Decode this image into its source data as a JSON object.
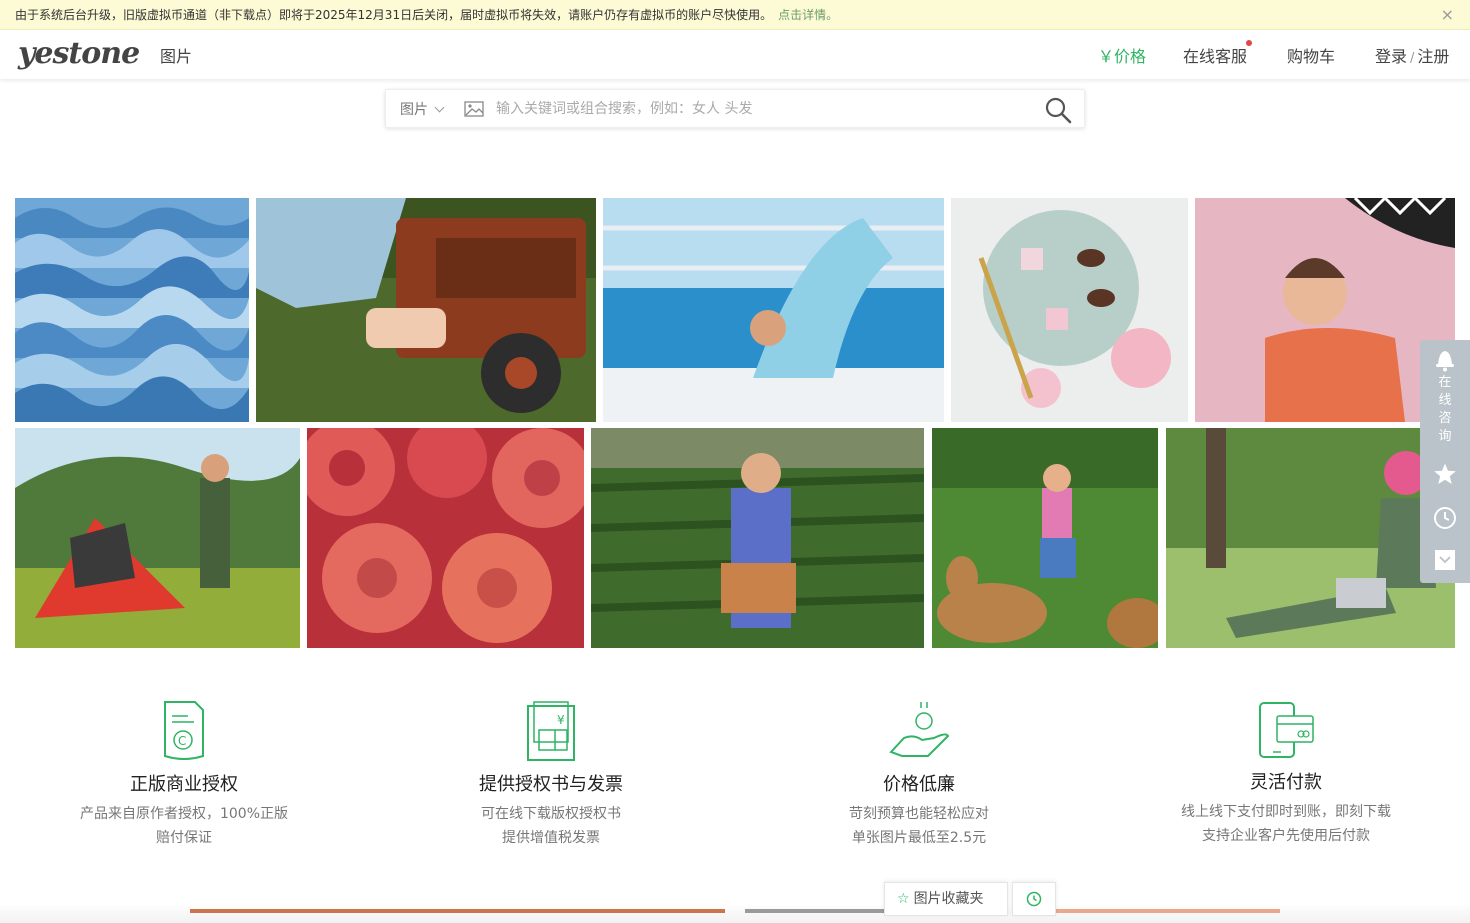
{
  "notice": {
    "text": "由于系统后台升级，旧版虚拟币通道（非下载点）即将于2025年12月31日后关闭，届时虚拟币将失效，请账户仍存有虚拟币的账户尽快使用。",
    "link": "点击详情。",
    "close": "×"
  },
  "header": {
    "logo": "yestone",
    "nav_pictures": "图片",
    "nav_price": "￥价格",
    "nav_service": "在线客服",
    "nav_cart": "购物车",
    "nav_login": "登录",
    "nav_login_sep": "/",
    "nav_register": "注册"
  },
  "search": {
    "type": "图片",
    "placeholder": "输入关键词或组合搜索，例如：女人 头发"
  },
  "features": [
    {
      "title": "正版商业授权",
      "desc1": "产品来自原作者授权，100%正版",
      "desc2": "赔付保证"
    },
    {
      "title": "提供授权书与发票",
      "desc1": "可在线下载版权授权书",
      "desc2": "提供增值税发票"
    },
    {
      "title": "价格低廉",
      "desc1": "苛刻预算也能轻松应对",
      "desc2": "单张图片最低至2.5元"
    },
    {
      "title": "灵活付款",
      "desc1": "线上线下支付即时到账，即刻下载",
      "desc2": "支持企业客户先使用后付款"
    }
  ],
  "sidebar": {
    "consult": "在线咨询"
  },
  "bottom": {
    "favorites": "图片收藏夹"
  },
  "colors": {
    "accent": "#2fb464",
    "notice_bg": "#fdfbd5",
    "sidebar_bg": "#b9c3c9"
  }
}
